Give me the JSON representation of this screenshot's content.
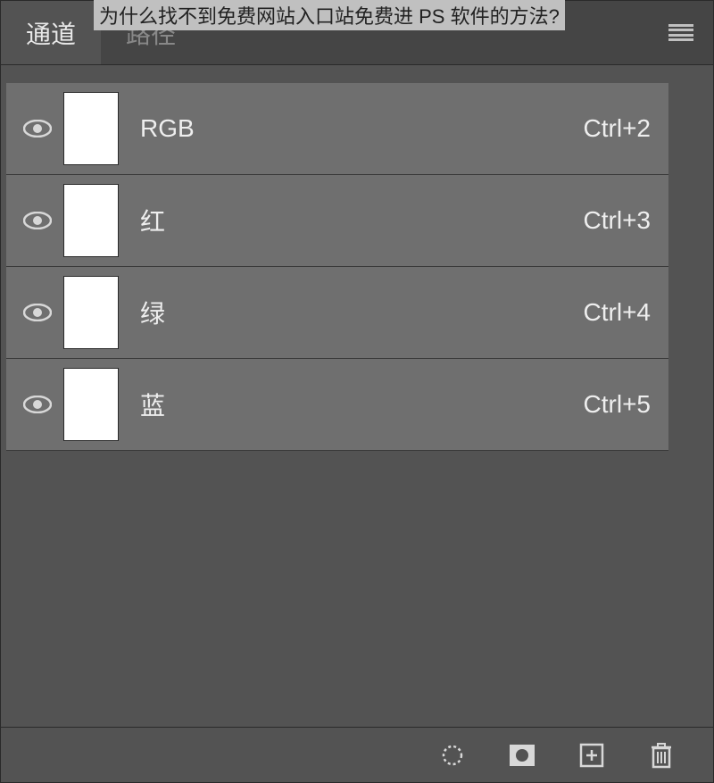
{
  "overlay_text": "为什么找不到免费网站入口站免费进 PS 软件的方法?",
  "tabs": {
    "active": "通道",
    "inactive": "路径"
  },
  "channels": [
    {
      "name": "RGB",
      "shortcut": "Ctrl+2"
    },
    {
      "name": "红",
      "shortcut": "Ctrl+3"
    },
    {
      "name": "绿",
      "shortcut": "Ctrl+4"
    },
    {
      "name": "蓝",
      "shortcut": "Ctrl+5"
    }
  ]
}
